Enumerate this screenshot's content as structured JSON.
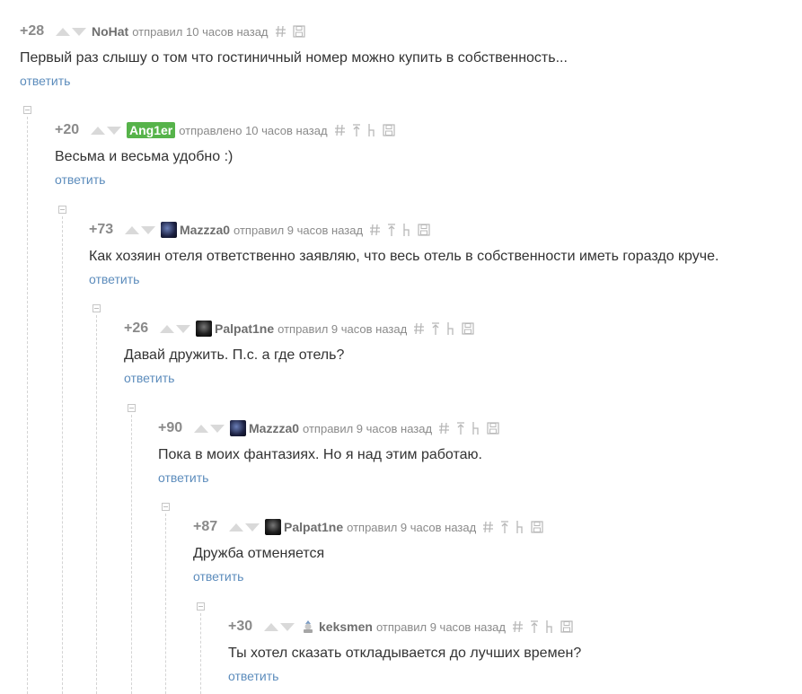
{
  "comments": [
    {
      "rating": "+28",
      "author": "NoHat",
      "avatar": "",
      "author_highlight": false,
      "meta": "отправил 10 часов назад",
      "text": "Первый раз слышу о том что гостиничный номер можно купить в собственность...",
      "reply": "ответить",
      "actions": [
        "link",
        "save"
      ]
    },
    {
      "rating": "+20",
      "author": "Ang1er",
      "avatar": "",
      "author_highlight": true,
      "meta": "отправлено 10 часов назад",
      "text": "Весьма и весьма удобно :)",
      "reply": "ответить",
      "actions": [
        "link",
        "parent",
        "thread",
        "save"
      ]
    },
    {
      "rating": "+73",
      "author": "Mazzza0",
      "avatar": "galaxy",
      "author_highlight": false,
      "meta": "отправил 9 часов назад",
      "text": "Как хозяин отеля ответственно заявляю, что весь отель в собственности иметь гораздо круче.",
      "reply": "ответить",
      "actions": [
        "link",
        "parent",
        "thread",
        "save"
      ]
    },
    {
      "rating": "+26",
      "author": "Palpat1ne",
      "avatar": "dark",
      "author_highlight": false,
      "meta": "отправил 9 часов назад",
      "text": "Давай дружить. П.с. а где отель?",
      "reply": "ответить",
      "actions": [
        "link",
        "parent",
        "thread",
        "save"
      ]
    },
    {
      "rating": "+90",
      "author": "Mazzza0",
      "avatar": "galaxy",
      "author_highlight": false,
      "meta": "отправил 9 часов назад",
      "text": "Пока в моих фантазиях. Но я над этим работаю.",
      "reply": "ответить",
      "actions": [
        "link",
        "parent",
        "thread",
        "save"
      ]
    },
    {
      "rating": "+87",
      "author": "Palpat1ne",
      "avatar": "dark",
      "author_highlight": false,
      "meta": "отправил 9 часов назад",
      "text": "Дружба отменяется",
      "reply": "ответить",
      "actions": [
        "link",
        "parent",
        "thread",
        "save"
      ]
    },
    {
      "rating": "+30",
      "author": "keksmen",
      "avatar": "cat",
      "author_highlight": false,
      "meta": "отправил 9 часов назад",
      "text": "Ты хотел сказать откладывается до лучших времен?",
      "reply": "ответить",
      "actions": [
        "link",
        "parent",
        "thread",
        "save"
      ]
    }
  ],
  "icons": {
    "link": "hash-icon",
    "parent": "parent-arrow-icon",
    "thread": "thread-icon",
    "save": "save-icon"
  },
  "colors": {
    "reply_link": "#5c8cbc",
    "highlight_author_bg": "#56b34a",
    "muted": "#8a8a8a"
  }
}
